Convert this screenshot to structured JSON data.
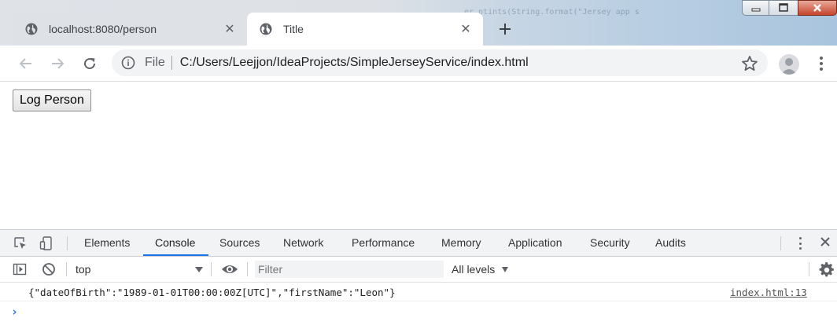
{
  "window": {
    "title": "Title",
    "background_code": "er.ptints(String.format(\"Jersey app s"
  },
  "tabs": [
    {
      "title": "localhost:8080/person",
      "icon": "globe-icon",
      "active": false
    },
    {
      "title": "Title",
      "icon": "globe-icon",
      "active": true
    }
  ],
  "toolbar": {
    "scheme_label": "File",
    "url": "C:/Users/Leejjon/IdeaProjects/SimpleJerseyService/index.html"
  },
  "page": {
    "log_button_label": "Log Person"
  },
  "devtools": {
    "tabs": [
      "Elements",
      "Console",
      "Sources",
      "Network",
      "Performance",
      "Memory",
      "Application",
      "Security",
      "Audits"
    ],
    "selected_tab": "Console",
    "context": "top",
    "filter_placeholder": "Filter",
    "levels": "All levels",
    "console": {
      "messages": [
        {
          "text": "{\"dateOfBirth\":\"1989-01-01T00:00:00Z[UTC]\",\"firstName\":\"Leon\"}",
          "source": "index.html:13"
        }
      ],
      "prompt": "›"
    },
    "accent_color": "#1a73e8"
  }
}
